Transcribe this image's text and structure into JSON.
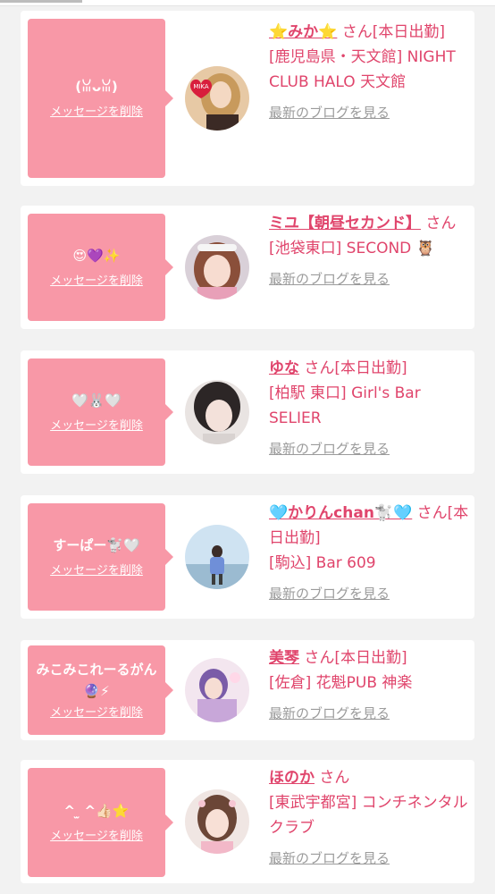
{
  "common": {
    "delete_label": "メッセージを削除",
    "blog_label": "最新のブログを見る",
    "accent_color": "#e0456c",
    "bubble_color": "#f898a7"
  },
  "cards": [
    {
      "message": "(ꈍᴗꈍ)",
      "name": "⭐みか⭐",
      "suffix": " さん[本日出勤]",
      "location": "[鹿児島県・天文館] NIGHT CLUB HALO 天文館"
    },
    {
      "message": "😍💜✨",
      "name": "ミユ【朝昼セカンド】",
      "suffix": " さん",
      "location": "[池袋東口] SECOND 🦉"
    },
    {
      "message": "🤍🐰🤍",
      "name": "ゆな",
      "suffix": " さん[本日出勤]",
      "location": "[柏駅 東口] Girl's Bar SELIER"
    },
    {
      "message": "すーぱー🐩🤍",
      "name": "🩵かりんchan🐩🩵",
      "suffix": " さん[本日出勤]",
      "location": "[駒込] Bar 609"
    },
    {
      "message": "みこみこれーるがん🔮⚡",
      "name": "美琴",
      "suffix": " さん[本日出勤]",
      "location": "[佐倉] 花魁PUB 神楽"
    },
    {
      "message": "^ ̫ ^👍🏻⭐",
      "name": "ほのか",
      "suffix": " さん",
      "location": "[東武宇都宮] コンチネンタルクラブ"
    }
  ]
}
